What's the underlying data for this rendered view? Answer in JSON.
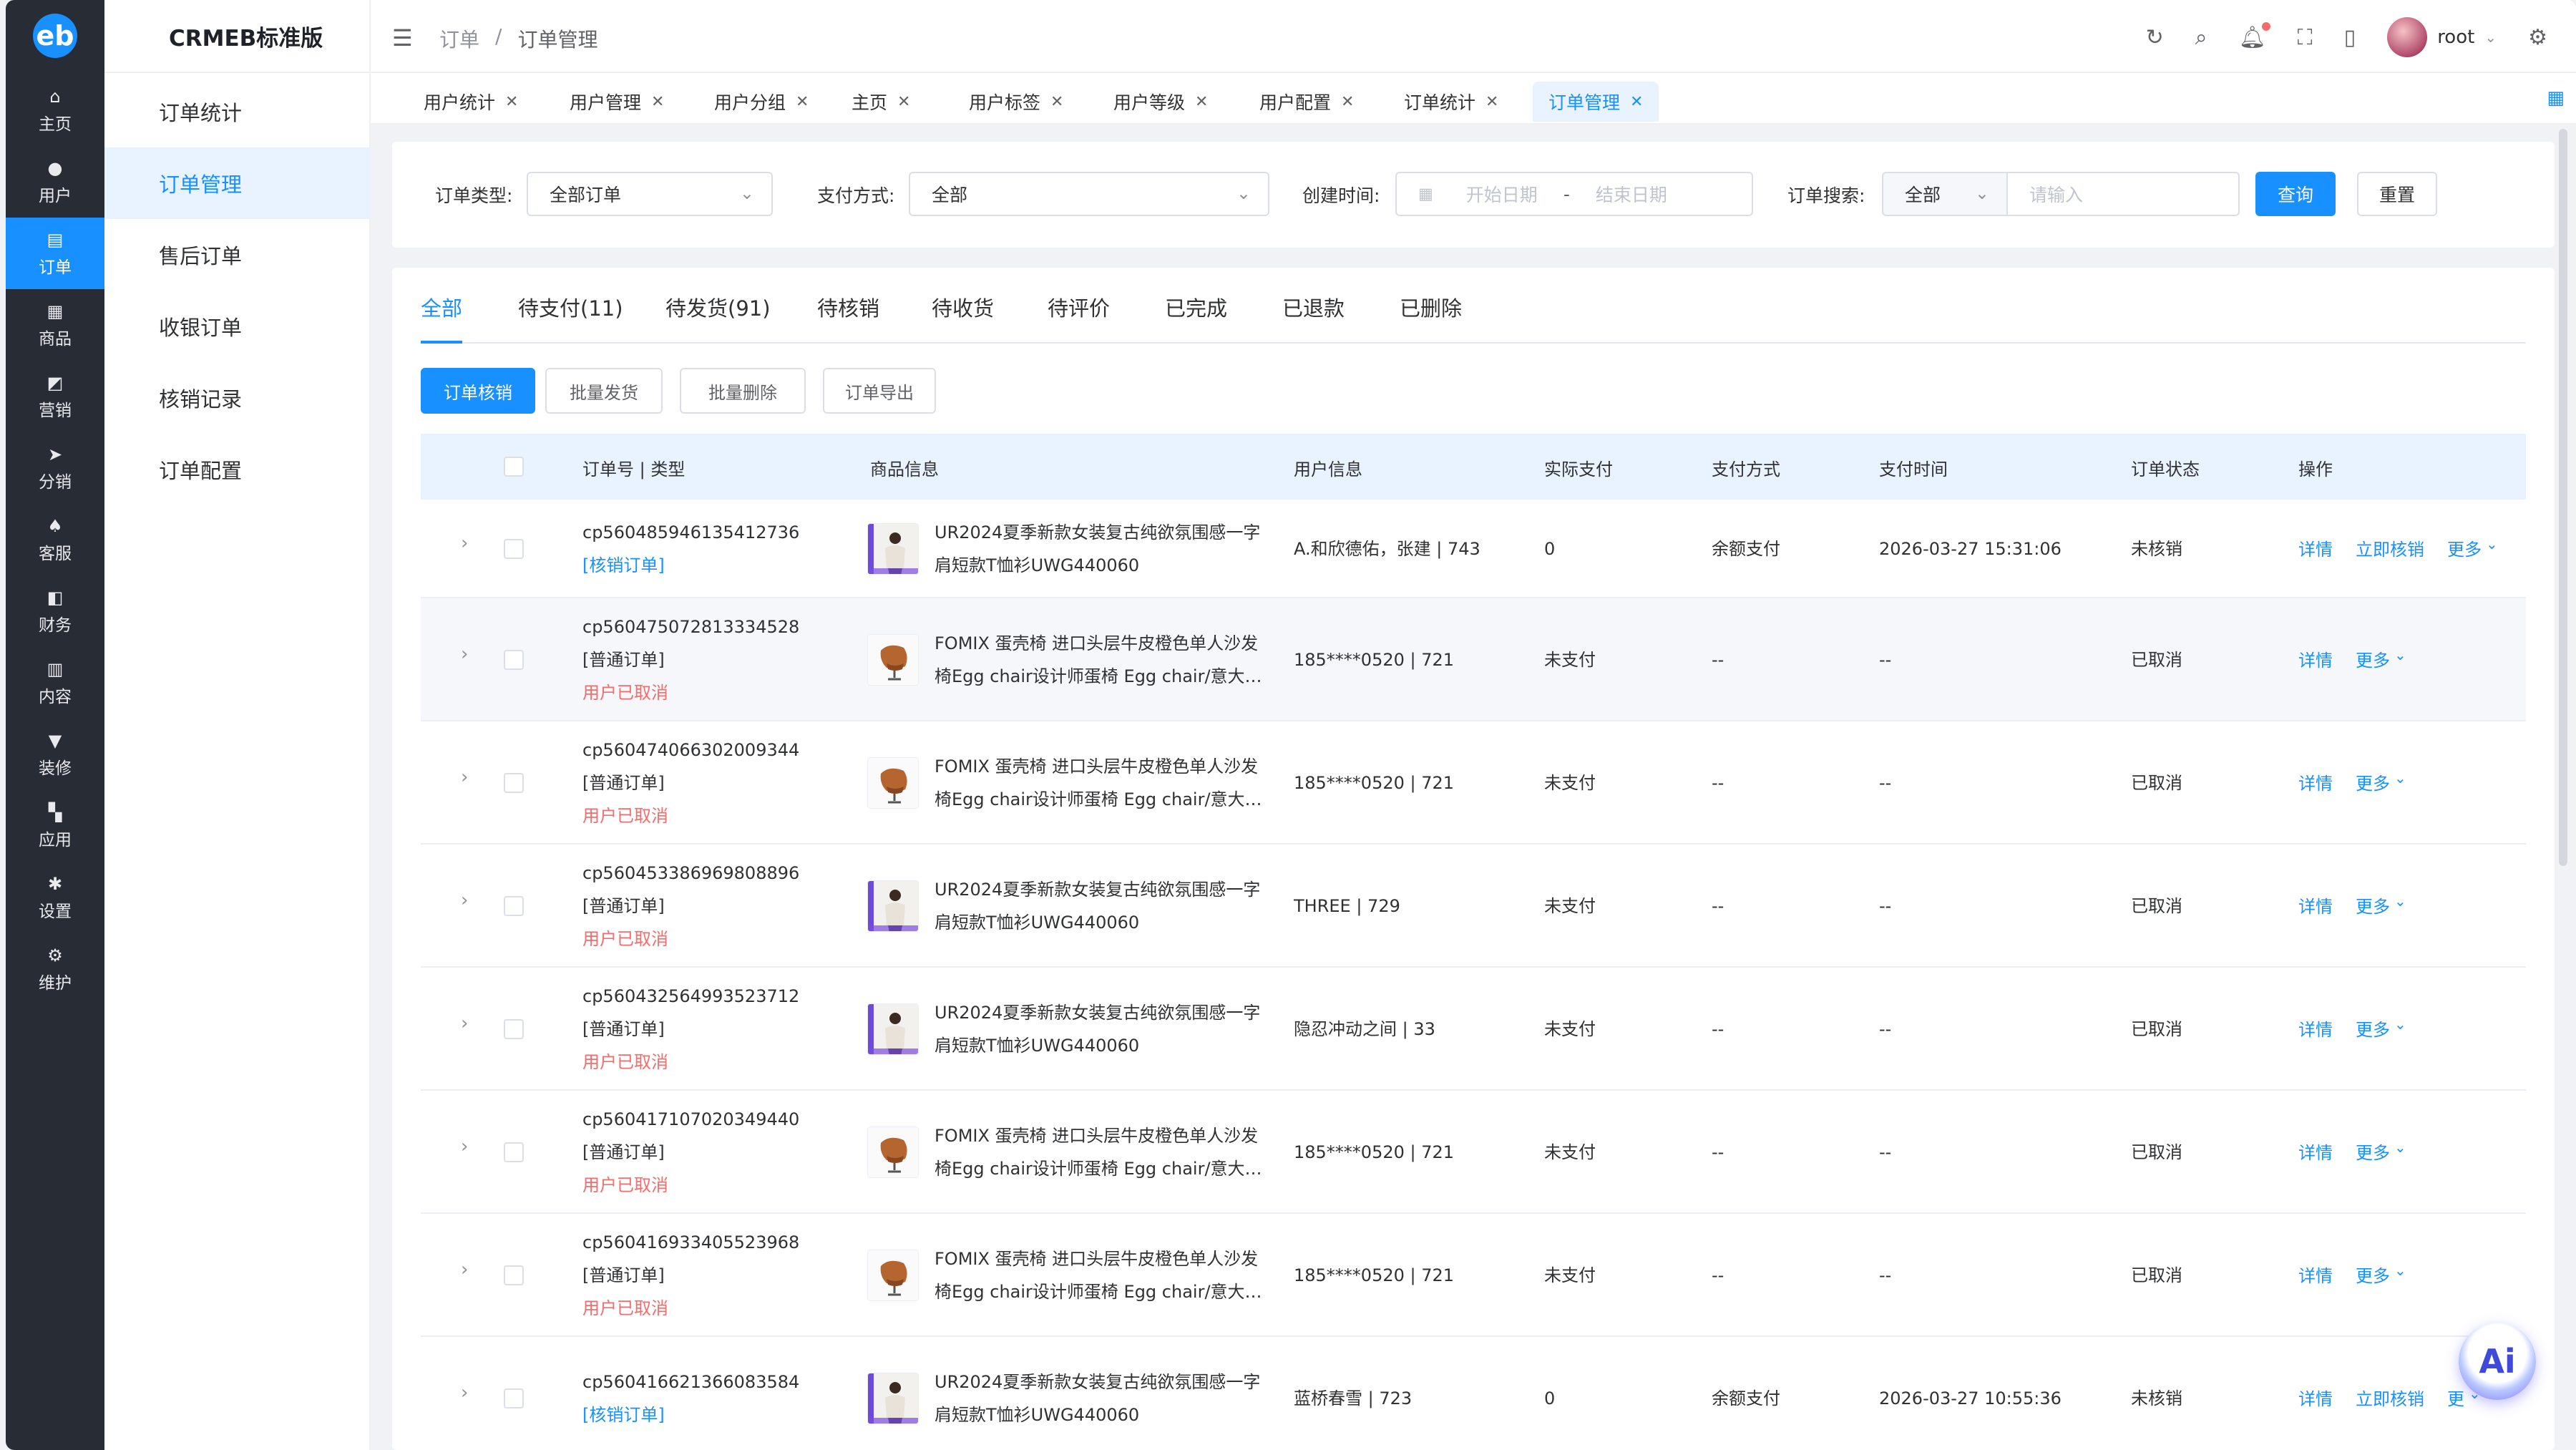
{
  "brand": {
    "name": "CRMEB标准版",
    "logo": "eb"
  },
  "nav": [
    {
      "label": "主页",
      "icon": "home-icon",
      "glyph": "⌂"
    },
    {
      "label": "用户",
      "icon": "user-icon",
      "glyph": "●"
    },
    {
      "label": "订单",
      "icon": "order-icon",
      "glyph": "▤",
      "active": true
    },
    {
      "label": "商品",
      "icon": "product-icon",
      "glyph": "▦"
    },
    {
      "label": "营销",
      "icon": "marketing-icon",
      "glyph": "◩"
    },
    {
      "label": "分销",
      "icon": "distribution-icon",
      "glyph": "➤"
    },
    {
      "label": "客服",
      "icon": "service-icon",
      "glyph": "♠"
    },
    {
      "label": "财务",
      "icon": "finance-icon",
      "glyph": "◧"
    },
    {
      "label": "内容",
      "icon": "content-icon",
      "glyph": "▥"
    },
    {
      "label": "装修",
      "icon": "decorate-icon",
      "glyph": "▼"
    },
    {
      "label": "应用",
      "icon": "apps-icon",
      "glyph": "▚"
    },
    {
      "label": "设置",
      "icon": "settings-icon",
      "glyph": "✱"
    },
    {
      "label": "维护",
      "icon": "maintain-icon",
      "glyph": "⚙"
    }
  ],
  "subnav": [
    {
      "label": "订单统计"
    },
    {
      "label": "订单管理",
      "active": true
    },
    {
      "label": "售后订单"
    },
    {
      "label": "收银订单"
    },
    {
      "label": "核销记录"
    },
    {
      "label": "订单配置"
    }
  ],
  "header": {
    "breadcrumb": [
      "订单",
      "/",
      "订单管理"
    ],
    "username": "root"
  },
  "tags": [
    {
      "label": "用户统计"
    },
    {
      "label": "用户管理"
    },
    {
      "label": "用户分组"
    },
    {
      "label": "主页"
    },
    {
      "label": "用户标签"
    },
    {
      "label": "用户等级"
    },
    {
      "label": "用户配置"
    },
    {
      "label": "订单统计"
    },
    {
      "label": "订单管理",
      "active": true
    }
  ],
  "filters": {
    "order_type_label": "订单类型:",
    "order_type_value": "全部订单",
    "pay_method_label": "支付方式:",
    "pay_method_value": "全部",
    "created_label": "创建时间:",
    "start_placeholder": "开始日期",
    "date_sep": "-",
    "end_placeholder": "结束日期",
    "search_label": "订单搜索:",
    "search_scope": "全部",
    "search_placeholder": "请输入",
    "query": "查询",
    "reset": "重置"
  },
  "tabs": [
    {
      "label": "全部",
      "active": true
    },
    {
      "label": "待支付(11)"
    },
    {
      "label": "待发货(91)"
    },
    {
      "label": "待核销"
    },
    {
      "label": "待收货"
    },
    {
      "label": "待评价"
    },
    {
      "label": "已完成"
    },
    {
      "label": "已退款"
    },
    {
      "label": "已删除"
    }
  ],
  "actions": [
    "订单核销",
    "批量发货",
    "批量删除",
    "订单导出"
  ],
  "columns": [
    "订单号 | 类型",
    "商品信息",
    "用户信息",
    "实际支付",
    "支付方式",
    "支付时间",
    "订单状态",
    "操作"
  ],
  "rows": [
    {
      "id": "cp560485946135412736",
      "type": "[核销订单]",
      "type_kind": "verify",
      "cancel": "",
      "goods1": "UR2024夏季新款女装复古纯欲氛围感一字",
      "goods2": "肩短款T恤衫UWG440060",
      "goods_kind": "shirt",
      "user": "A.和欣德佑，张建 | 743",
      "paid": "0",
      "method": "余额支付",
      "time": "2026-03-27 15:31:06",
      "status": "未核销",
      "op1": "详情",
      "op2": "立即核销",
      "op3": "更多"
    },
    {
      "id": "cp560475072813334528",
      "type": "[普通订单]",
      "type_kind": "normal",
      "cancel": "用户已取消",
      "goods1": "FOMIX 蛋壳椅 进口头层牛皮橙色单人沙发",
      "goods2": "椅Egg chair设计师蛋椅 Egg chair/意大…",
      "goods_kind": "chair",
      "user": "185****0520 | 721",
      "paid": "未支付",
      "method": "--",
      "time": "--",
      "status": "已取消",
      "op1": "详情",
      "op2": "",
      "op3": "更多"
    },
    {
      "id": "cp560474066302009344",
      "type": "[普通订单]",
      "type_kind": "normal",
      "cancel": "用户已取消",
      "goods1": "FOMIX 蛋壳椅 进口头层牛皮橙色单人沙发",
      "goods2": "椅Egg chair设计师蛋椅 Egg chair/意大…",
      "goods_kind": "chair",
      "user": "185****0520 | 721",
      "paid": "未支付",
      "method": "--",
      "time": "--",
      "status": "已取消",
      "op1": "详情",
      "op2": "",
      "op3": "更多"
    },
    {
      "id": "cp560453386969808896",
      "type": "[普通订单]",
      "type_kind": "normal",
      "cancel": "用户已取消",
      "goods1": "UR2024夏季新款女装复古纯欲氛围感一字",
      "goods2": "肩短款T恤衫UWG440060",
      "goods_kind": "shirt",
      "user": "THREE | 729",
      "paid": "未支付",
      "method": "--",
      "time": "--",
      "status": "已取消",
      "op1": "详情",
      "op2": "",
      "op3": "更多"
    },
    {
      "id": "cp560432564993523712",
      "type": "[普通订单]",
      "type_kind": "normal",
      "cancel": "用户已取消",
      "goods1": "UR2024夏季新款女装复古纯欲氛围感一字",
      "goods2": "肩短款T恤衫UWG440060",
      "goods_kind": "shirt",
      "user": "隐忍冲动之间 | 33",
      "paid": "未支付",
      "method": "--",
      "time": "--",
      "status": "已取消",
      "op1": "详情",
      "op2": "",
      "op3": "更多"
    },
    {
      "id": "cp560417107020349440",
      "type": "[普通订单]",
      "type_kind": "normal",
      "cancel": "用户已取消",
      "goods1": "FOMIX 蛋壳椅 进口头层牛皮橙色单人沙发",
      "goods2": "椅Egg chair设计师蛋椅 Egg chair/意大…",
      "goods_kind": "chair",
      "user": "185****0520 | 721",
      "paid": "未支付",
      "method": "--",
      "time": "--",
      "status": "已取消",
      "op1": "详情",
      "op2": "",
      "op3": "更多"
    },
    {
      "id": "cp560416933405523968",
      "type": "[普通订单]",
      "type_kind": "normal",
      "cancel": "用户已取消",
      "goods1": "FOMIX 蛋壳椅 进口头层牛皮橙色单人沙发",
      "goods2": "椅Egg chair设计师蛋椅 Egg chair/意大…",
      "goods_kind": "chair",
      "user": "185****0520 | 721",
      "paid": "未支付",
      "method": "--",
      "time": "--",
      "status": "已取消",
      "op1": "详情",
      "op2": "",
      "op3": "更多"
    },
    {
      "id": "cp560416621366083584",
      "type": "[核销订单]",
      "type_kind": "verify",
      "cancel": "",
      "goods1": "UR2024夏季新款女装复古纯欲氛围感一字",
      "goods2": "肩短款T恤衫UWG440060",
      "goods_kind": "shirt",
      "user": "蓝桥春雪 | 723",
      "paid": "0",
      "method": "余额支付",
      "time": "2026-03-27 10:55:36",
      "status": "未核销",
      "op1": "详情",
      "op2": "立即核销",
      "op3": "更"
    }
  ],
  "fab": {
    "label": "Ai"
  },
  "colors": {
    "primary": "#1890ff",
    "sidebar": "#282c34",
    "danger": "#f56c6c",
    "header_row": "#e8f3ff"
  }
}
